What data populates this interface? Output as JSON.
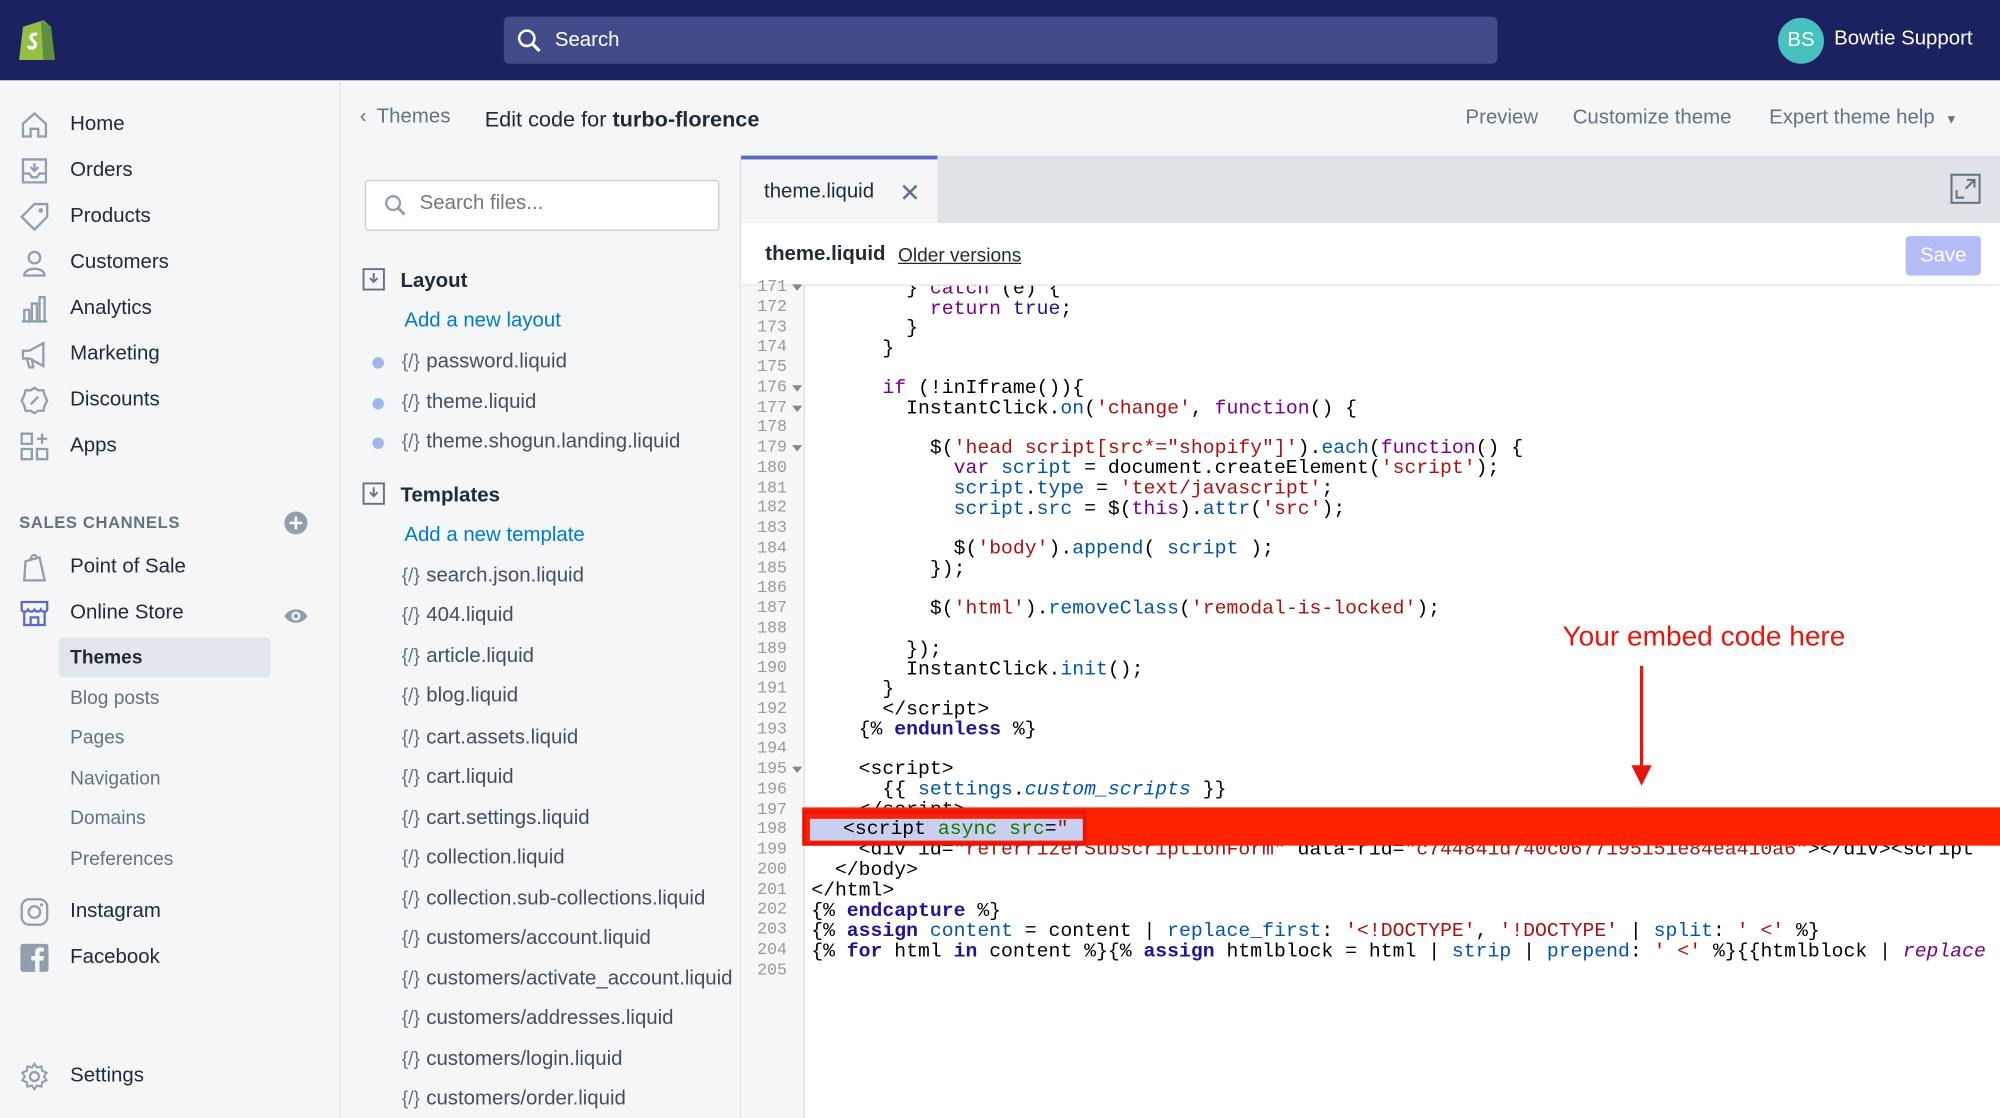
{
  "topbar": {
    "search_placeholder": "Search",
    "avatar_initials": "BS",
    "user_name": "Bowtie Support"
  },
  "sidebar": {
    "items": [
      {
        "label": "Home",
        "icon": "home-icon"
      },
      {
        "label": "Orders",
        "icon": "orders-icon"
      },
      {
        "label": "Products",
        "icon": "tag-icon"
      },
      {
        "label": "Customers",
        "icon": "person-icon"
      },
      {
        "label": "Analytics",
        "icon": "bar-chart-icon"
      },
      {
        "label": "Marketing",
        "icon": "megaphone-icon"
      },
      {
        "label": "Discounts",
        "icon": "discount-icon"
      },
      {
        "label": "Apps",
        "icon": "apps-icon"
      }
    ],
    "sales_channels_label": "SALES CHANNELS",
    "channels": [
      {
        "label": "Point of Sale"
      },
      {
        "label": "Online Store"
      }
    ],
    "online_store_sub": [
      "Themes",
      "Blog posts",
      "Pages",
      "Navigation",
      "Domains",
      "Preferences"
    ],
    "social": [
      {
        "label": "Instagram"
      },
      {
        "label": "Facebook"
      }
    ],
    "settings_label": "Settings"
  },
  "header": {
    "back_label": "Themes",
    "title_prefix": "Edit code for ",
    "theme_name": "turbo-florence",
    "preview": "Preview",
    "customize": "Customize theme",
    "expert": "Expert theme help"
  },
  "files": {
    "search_placeholder": "Search files...",
    "layout_label": "Layout",
    "add_layout": "Add a new layout",
    "layout_files": [
      "password.liquid",
      "theme.liquid",
      "theme.shogun.landing.liquid"
    ],
    "templates_label": "Templates",
    "add_template": "Add a new template",
    "template_files": [
      "search.json.liquid",
      "404.liquid",
      "article.liquid",
      "blog.liquid",
      "cart.assets.liquid",
      "cart.liquid",
      "cart.settings.liquid",
      "collection.liquid",
      "collection.sub-collections.liquid",
      "customers/account.liquid",
      "customers/activate_account.liquid",
      "customers/addresses.liquid",
      "customers/login.liquid",
      "customers/order.liquid"
    ]
  },
  "editor": {
    "tab_label": "theme.liquid",
    "file_name": "theme.liquid",
    "older_versions": "Older versions",
    "save_label": "Save",
    "line_numbers": [
      "171",
      "172",
      "173",
      "174",
      "175",
      "176",
      "177",
      "178",
      "179",
      "180",
      "181",
      "182",
      "183",
      "184",
      "185",
      "186",
      "187",
      "188",
      "189",
      "190",
      "191",
      "192",
      "193",
      "194",
      "195",
      "196",
      "197",
      "198",
      "199",
      "200",
      "201",
      "202",
      "203",
      "204",
      "205"
    ]
  },
  "annotation": {
    "text": "Your embed code here",
    "color": "#e8150b"
  }
}
